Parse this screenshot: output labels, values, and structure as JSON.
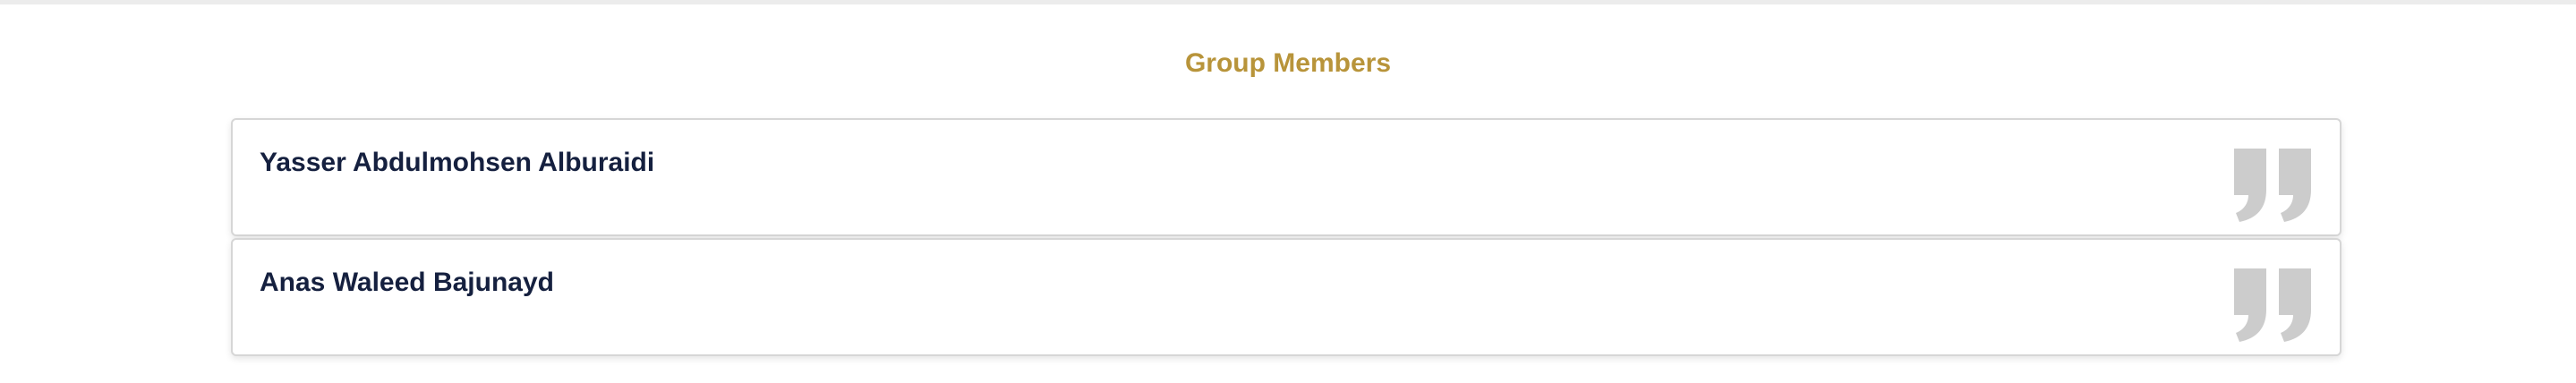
{
  "section": {
    "title": "Group Members"
  },
  "members": [
    {
      "name": "Yasser Abdulmohsen Alburaidi",
      "icon": "quote-icon"
    },
    {
      "name": "Anas Waleed Bajunayd",
      "icon": "quote-icon"
    }
  ],
  "colors": {
    "title": "#b8943a",
    "name": "#15203f",
    "icon": "#cccccc",
    "card_border": "#d6d6d6"
  }
}
